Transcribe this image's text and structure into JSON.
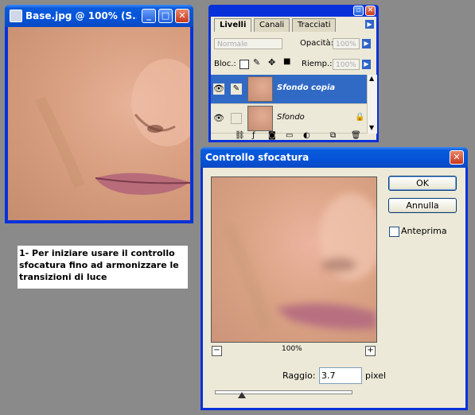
{
  "image_window": {
    "title": "Base.jpg @ 100% (S...",
    "buttons": {
      "minimize": "_",
      "maximize": "□",
      "close": "✕"
    }
  },
  "layers_panel": {
    "tabs": [
      "Livelli",
      "Canali",
      "Tracciati"
    ],
    "blend_mode": "Normale",
    "opacity_label": "Opacità:",
    "opacity_value": "100%",
    "lock_label": "Bloc.:",
    "fill_label": "Riemp.:",
    "fill_value": "100%",
    "layers": [
      {
        "name": "Sfondo copia",
        "selected": true
      },
      {
        "name": "Sfondo",
        "selected": false
      }
    ]
  },
  "blur_dialog": {
    "title": "Controllo sfocatura",
    "ok_label": "OK",
    "cancel_label": "Annulla",
    "preview_label": "Anteprima",
    "zoom_level": "100%",
    "zoom_out": "−",
    "zoom_in": "+",
    "radius_label": "Raggio:",
    "radius_value": "3.7",
    "radius_unit": "pixel",
    "slider_fraction": 0.2
  },
  "instructions": {
    "text": "1- Per iniziare usare il controllo sfocatura fino ad armonizzare le transizioni di luce"
  },
  "colors": {
    "xp_blue": "#0831d9",
    "dialog_face": "#ece9d8",
    "selection": "#316ac5",
    "desktop": "#8a8a8a"
  }
}
